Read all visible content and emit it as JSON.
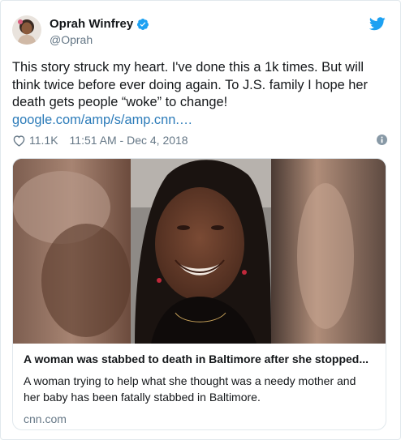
{
  "tweet": {
    "display_name": "Oprah Winfrey",
    "handle": "@Oprah",
    "text": "This story struck my heart. I've done this a 1k times. But will think twice before ever doing again. To J.S. family I hope her death gets people “woke” to change!",
    "link": "google.com/amp/s/amp.cnn.…",
    "like_count": "11.1K",
    "timestamp": "11:51 AM - Dec 4, 2018"
  },
  "card": {
    "title": "A woman was stabbed to death in Baltimore after she stopped...",
    "description": "A woman trying to help what she thought was a needy mother and her baby has been fatally stabbed in Baltimore.",
    "domain": "cnn.com"
  },
  "icons": {
    "verified": "verified-badge-icon",
    "twitter": "twitter-bird-icon",
    "like": "heart-icon",
    "info": "info-icon"
  },
  "colors": {
    "link": "#2b7bb9",
    "twitter_blue": "#1da1f2",
    "secondary_text": "#657786",
    "primary_text": "#14171a",
    "border": "#e1e8ed"
  }
}
